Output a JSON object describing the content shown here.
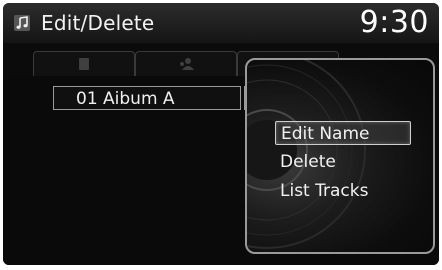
{
  "header": {
    "title": "Edit/Delete",
    "clock": "9:30",
    "title_icon": "music-note-icon"
  },
  "tabs": [
    {
      "icon": "album-icon"
    },
    {
      "icon": "artist-icon"
    },
    {
      "icon": "disc-icon"
    }
  ],
  "list": {
    "items": [
      {
        "label": "01 Aibum A"
      }
    ]
  },
  "menu": {
    "items": [
      {
        "label": "Edit Name",
        "selected": true
      },
      {
        "label": "Delete",
        "selected": false
      },
      {
        "label": "List Tracks",
        "selected": false
      }
    ]
  },
  "colors": {
    "background": "#0b0b0b",
    "text": "#f2f2f2",
    "border": "#9a9a9a"
  }
}
